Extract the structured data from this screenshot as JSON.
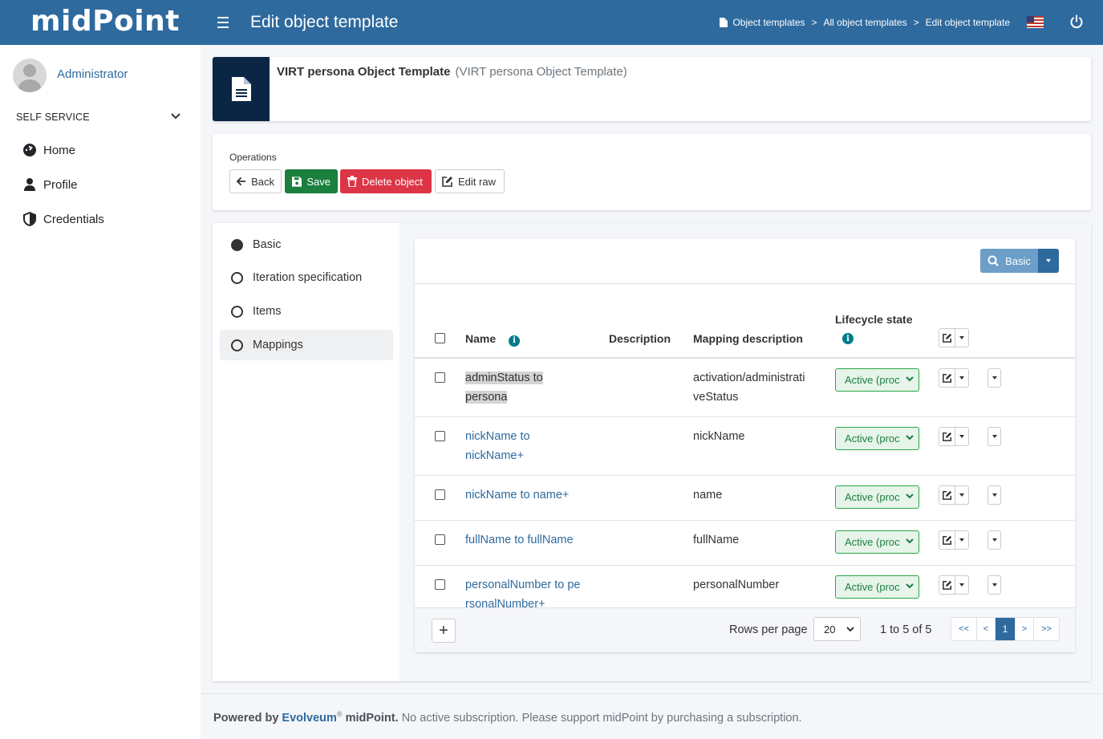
{
  "header": {
    "logo": "midPoint",
    "title": "Edit object template",
    "breadcrumbs": [
      "Object templates",
      "All object templates",
      "Edit object template"
    ],
    "breadcrumb_separator": ">"
  },
  "sidebar": {
    "user_name": "Administrator",
    "section_label": "SELF SERVICE",
    "items": [
      {
        "label": "Home",
        "icon": "dashboard-icon"
      },
      {
        "label": "Profile",
        "icon": "user-icon"
      },
      {
        "label": "Credentials",
        "icon": "shield-icon"
      }
    ]
  },
  "object": {
    "name": "VIRT persona Object Template",
    "display_name": "(VIRT persona Object Template)",
    "icon": "file-icon"
  },
  "operations": {
    "label": "Operations",
    "back_label": "Back",
    "save_label": "Save",
    "delete_label": "Delete object",
    "edit_raw_label": "Edit raw"
  },
  "tabs": [
    {
      "label": "Basic",
      "selected": true
    },
    {
      "label": "Iteration specification",
      "selected": false
    },
    {
      "label": "Items",
      "selected": false
    },
    {
      "label": "Mappings",
      "selected": false
    }
  ],
  "table": {
    "search_label": "Basic",
    "columns": {
      "name": "Name",
      "description": "Description",
      "mapping_description": "Mapping description",
      "lifecycle_state": "Lifecycle state"
    },
    "rows": [
      {
        "name_line1": "adminStatus to",
        "name_line2": "persona",
        "mapping_line1": "activation/administrati",
        "mapping_line2": "veStatus",
        "lifecycle": "Active (proc"
      },
      {
        "name_line1": "nickName to",
        "name_line2": "nickName+",
        "mapping_line1": "nickName",
        "mapping_line2": "",
        "lifecycle": "Active (proc"
      },
      {
        "name_line1": "nickName to name+",
        "name_line2": "",
        "mapping_line1": "name",
        "mapping_line2": "",
        "lifecycle": "Active (proc"
      },
      {
        "name_line1": "fullName to fullName",
        "name_line2": "",
        "mapping_line1": "fullName",
        "mapping_line2": "",
        "lifecycle": "Active (proc"
      },
      {
        "name_line1": "personalNumber to pe",
        "name_line2": "rsonalNumber+",
        "mapping_line1": "personalNumber",
        "mapping_line2": "",
        "lifecycle": "Active (proc"
      }
    ],
    "add_label": "+",
    "rows_per_page_label": "Rows per page",
    "rows_per_page_value": "20",
    "range_label": "1 to 5 of 5",
    "pager": {
      "first": "<<",
      "prev": "<",
      "current": "1",
      "next": ">",
      "last": ">>"
    }
  },
  "footer": {
    "powered_by": "Powered by",
    "vendor": "Evolveum",
    "registered": "®",
    "product": "midPoint.",
    "message": "No active subscription. Please support midPoint by purchasing a subscription."
  },
  "colors": {
    "header_bg": "#2e6a9e",
    "save_green": "#1b7f3e",
    "delete_red": "#dc3545",
    "object_icon_bg": "#0b2545"
  }
}
